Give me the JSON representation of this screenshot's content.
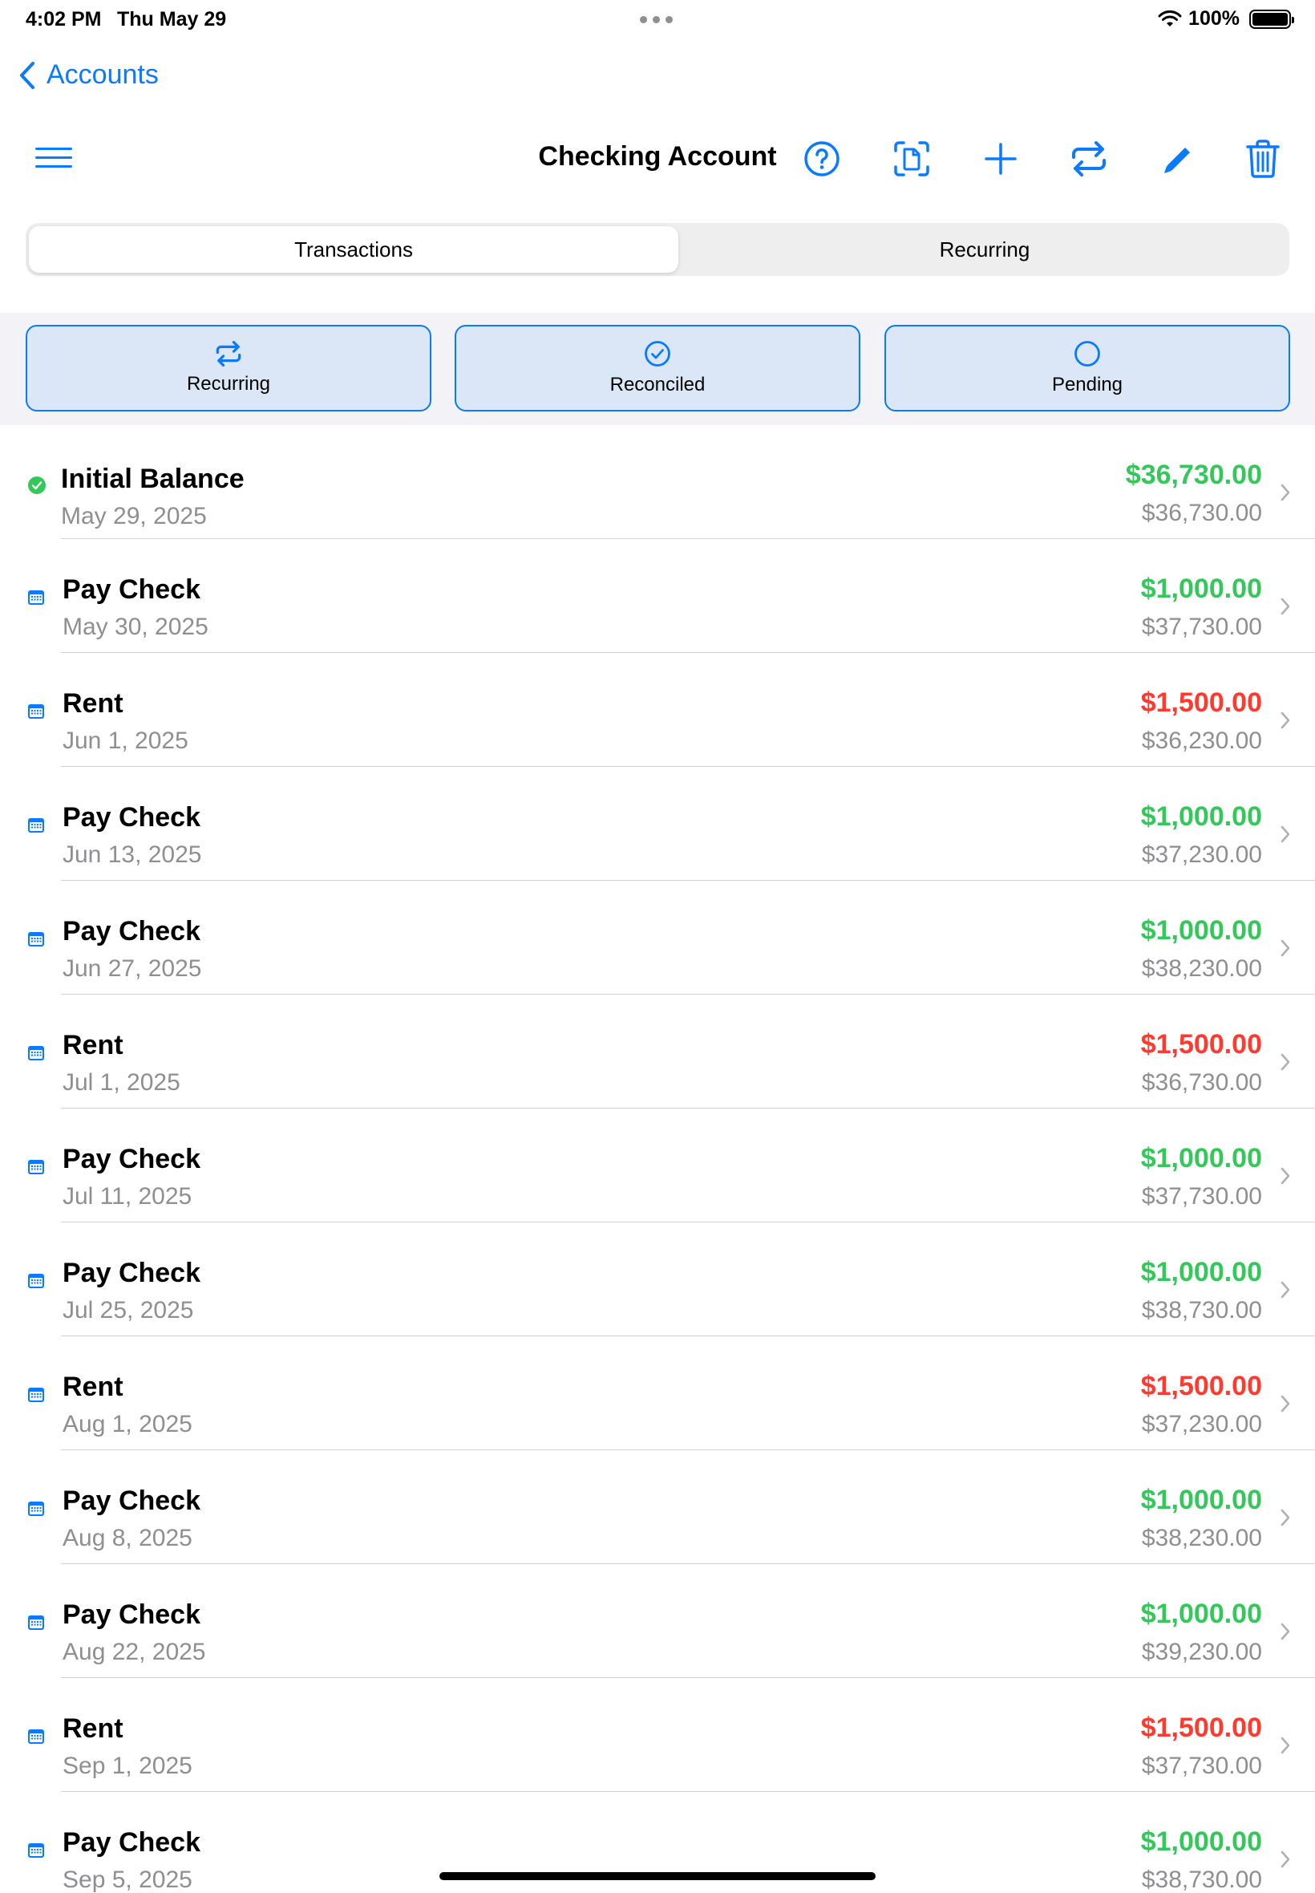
{
  "status_bar": {
    "time": "4:02 PM",
    "date": "Thu May 29",
    "battery": "100%"
  },
  "nav": {
    "back_label": "Accounts"
  },
  "header": {
    "title": "Checking Account"
  },
  "toolbar_icons": [
    "help-icon",
    "scan-document-icon",
    "plus-icon",
    "transfer-icon",
    "pencil-icon",
    "trash-icon"
  ],
  "segments": {
    "transactions": "Transactions",
    "recurring": "Recurring"
  },
  "filters": {
    "recurring": "Recurring",
    "reconciled": "Reconciled",
    "pending": "Pending"
  },
  "colors": {
    "accent": "#0a7aff",
    "positive": "#34c759",
    "negative": "#ff3b30",
    "secondary_text": "#8e8e93"
  },
  "transactions": [
    {
      "name": "Initial Balance",
      "date": "May 29, 2025",
      "amount": "$36,730.00",
      "balance": "$36,730.00",
      "type": "positive",
      "status": "reconciled"
    },
    {
      "name": "Pay Check",
      "date": "May 30, 2025",
      "amount": "$1,000.00",
      "balance": "$37,730.00",
      "type": "positive",
      "status": "scheduled"
    },
    {
      "name": "Rent",
      "date": "Jun 1, 2025",
      "amount": "$1,500.00",
      "balance": "$36,230.00",
      "type": "negative",
      "status": "scheduled"
    },
    {
      "name": "Pay Check",
      "date": "Jun 13, 2025",
      "amount": "$1,000.00",
      "balance": "$37,230.00",
      "type": "positive",
      "status": "scheduled"
    },
    {
      "name": "Pay Check",
      "date": "Jun 27, 2025",
      "amount": "$1,000.00",
      "balance": "$38,230.00",
      "type": "positive",
      "status": "scheduled"
    },
    {
      "name": "Rent",
      "date": "Jul 1, 2025",
      "amount": "$1,500.00",
      "balance": "$36,730.00",
      "type": "negative",
      "status": "scheduled"
    },
    {
      "name": "Pay Check",
      "date": "Jul 11, 2025",
      "amount": "$1,000.00",
      "balance": "$37,730.00",
      "type": "positive",
      "status": "scheduled"
    },
    {
      "name": "Pay Check",
      "date": "Jul 25, 2025",
      "amount": "$1,000.00",
      "balance": "$38,730.00",
      "type": "positive",
      "status": "scheduled"
    },
    {
      "name": "Rent",
      "date": "Aug 1, 2025",
      "amount": "$1,500.00",
      "balance": "$37,230.00",
      "type": "negative",
      "status": "scheduled"
    },
    {
      "name": "Pay Check",
      "date": "Aug 8, 2025",
      "amount": "$1,000.00",
      "balance": "$38,230.00",
      "type": "positive",
      "status": "scheduled"
    },
    {
      "name": "Pay Check",
      "date": "Aug 22, 2025",
      "amount": "$1,000.00",
      "balance": "$39,230.00",
      "type": "positive",
      "status": "scheduled"
    },
    {
      "name": "Rent",
      "date": "Sep 1, 2025",
      "amount": "$1,500.00",
      "balance": "$37,730.00",
      "type": "negative",
      "status": "scheduled"
    },
    {
      "name": "Pay Check",
      "date": "Sep 5, 2025",
      "amount": "$1,000.00",
      "balance": "$38,730.00",
      "type": "positive",
      "status": "scheduled"
    }
  ]
}
